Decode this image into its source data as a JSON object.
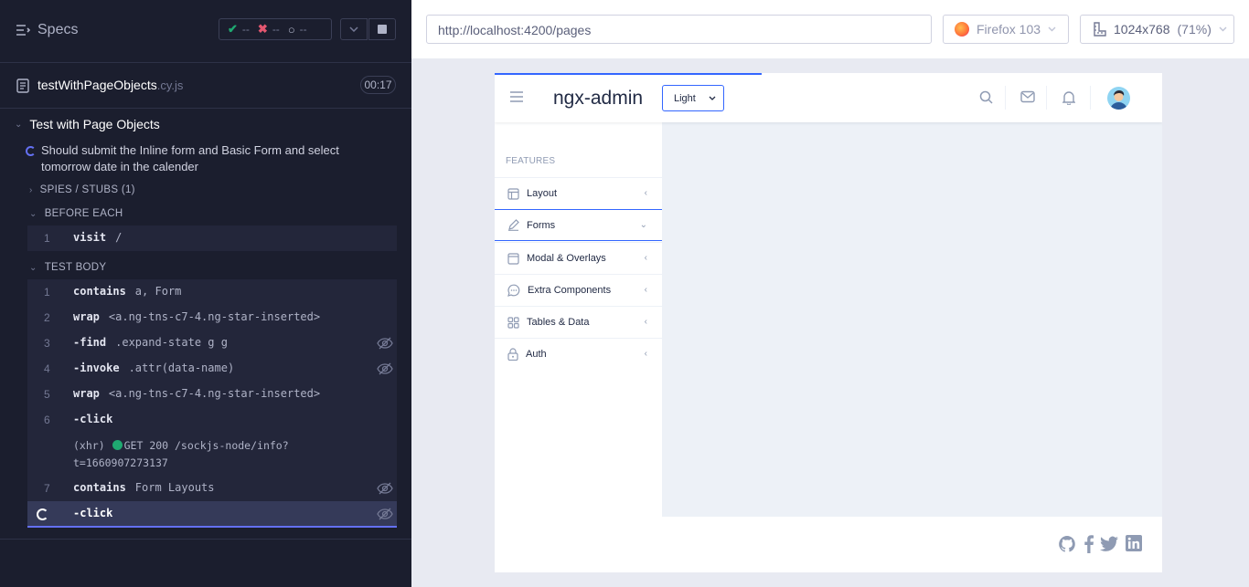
{
  "reporter": {
    "specs_label": "Specs",
    "stats": {
      "passed": "--",
      "failed": "--",
      "pending": "--"
    },
    "spec": {
      "name": "testWithPageObjects",
      "ext": ".cy.js",
      "duration": "00:17"
    },
    "suite_title": "Test with Page Objects",
    "test_title": "Should submit the Inline form and Basic Form and select tomorrow date in the calender",
    "spies_label": "SPIES / STUBS (1)",
    "before_each_label": "BEFORE EACH",
    "before_each_commands": [
      {
        "num": "1",
        "name": "visit",
        "message": "/"
      }
    ],
    "test_body_label": "TEST BODY",
    "commands": [
      {
        "num": "1",
        "name": "contains",
        "message": "a, Form"
      },
      {
        "num": "2",
        "name": "wrap",
        "message": "<a.ng-tns-c7-4.ng-star-inserted>"
      },
      {
        "num": "3",
        "name": "-find",
        "message": ".expand-state g g"
      },
      {
        "num": "4",
        "name": "-invoke",
        "message": ".attr(data-name)"
      },
      {
        "num": "5",
        "name": "wrap",
        "message": "<a.ng-tns-c7-4.ng-star-inserted>"
      },
      {
        "num": "6",
        "name": "-click",
        "message": ""
      },
      {
        "num": "7",
        "name": "contains",
        "message": "Form Layouts"
      },
      {
        "num": "",
        "name": "-click",
        "message": ""
      }
    ],
    "xhr": {
      "label": "(xhr)",
      "text": "GET 200 /sockjs-node/info?t=1660907273137"
    }
  },
  "aut": {
    "url": "http://localhost:4200/pages",
    "browser": "Firefox 103",
    "viewport": "1024x768",
    "zoom": "(71%)",
    "app": {
      "logo": "ngx-admin",
      "theme": "Light",
      "features_label": "FEATURES",
      "menu": [
        {
          "label": "Layout",
          "icon": "layout-icon",
          "arrow": "‹"
        },
        {
          "label": "Forms",
          "icon": "edit-icon",
          "arrow": "⌄"
        },
        {
          "label": "Modal & Overlays",
          "icon": "browser-icon",
          "arrow": "‹"
        },
        {
          "label": "Extra Components",
          "icon": "message-circle-icon",
          "arrow": "‹"
        },
        {
          "label": "Tables & Data",
          "icon": "grid-icon",
          "arrow": "‹"
        },
        {
          "label": "Auth",
          "icon": "lock-icon",
          "arrow": "‹"
        }
      ]
    }
  },
  "colors": {
    "accent": "#6470f3",
    "app_primary": "#3366ff",
    "pass": "#1fa971",
    "fail": "#e45770"
  }
}
